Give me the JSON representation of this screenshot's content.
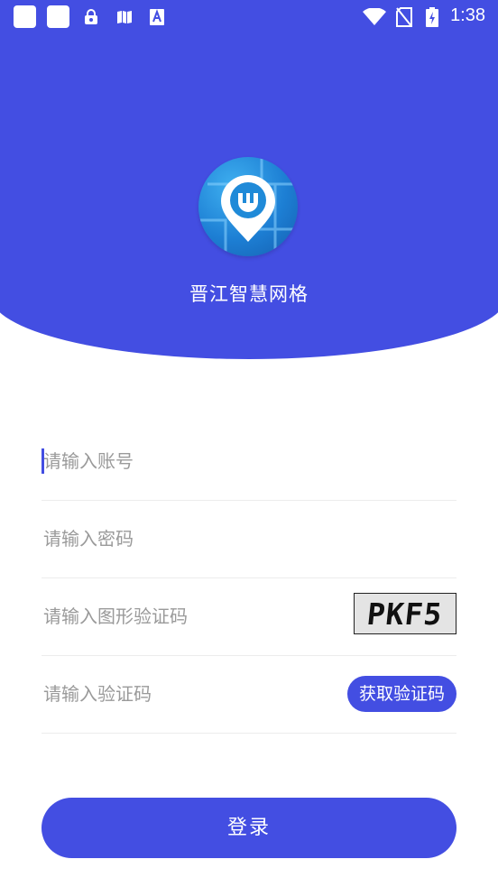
{
  "status_bar": {
    "time": "1:38",
    "icons": [
      "app-notification-icon",
      "app-notification-icon",
      "lock-bag-icon",
      "book-icon",
      "font-a-icon",
      "wifi-icon",
      "no-sim-icon",
      "battery-charging-icon"
    ]
  },
  "header": {
    "app_name": "晋江智慧网格",
    "logo": "map-pin-shield-logo"
  },
  "form": {
    "account_placeholder": "请输入账号",
    "password_placeholder": "请输入密码",
    "image_captcha_placeholder": "请输入图形验证码",
    "captcha_text": "PKF5",
    "sms_code_placeholder": "请输入验证码",
    "get_code_label": "获取验证码",
    "login_label": "登录"
  },
  "colors": {
    "primary": "#434ee2",
    "divider": "#ececec",
    "placeholder": "#9a9a9a"
  }
}
